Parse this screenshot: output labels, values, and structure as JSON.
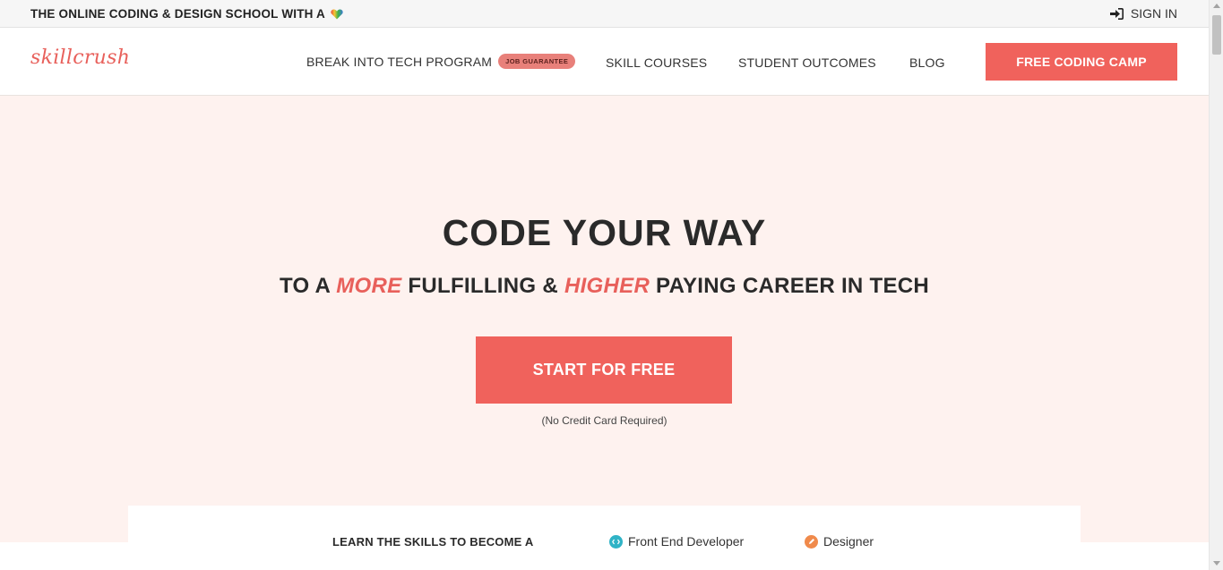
{
  "topbar": {
    "tagline": "THE ONLINE CODING & DESIGN SCHOOL WITH A",
    "tagline_icon": "rainbow-heart-icon",
    "signin_label": "SIGN IN",
    "signin_icon": "sign-in-arrow-icon"
  },
  "nav": {
    "logo": "skillcrush",
    "items": [
      {
        "label": "BREAK INTO TECH PROGRAM",
        "badge": "JOB GUARANTEE"
      },
      {
        "label": "SKILL COURSES"
      },
      {
        "label": "STUDENT OUTCOMES"
      },
      {
        "label": "BLOG"
      }
    ],
    "cta_label": "FREE CODING CAMP"
  },
  "hero": {
    "title": "CODE YOUR WAY",
    "subtitle_parts": [
      "TO A ",
      "MORE",
      " FULFILLING & ",
      "HIGHER",
      " PAYING CAREER IN TECH"
    ],
    "cta_label": "START FOR FREE",
    "note": "(No Credit Card Required)"
  },
  "skills": {
    "label": "LEARN THE SKILLS TO BECOME A",
    "items": [
      {
        "label": "Front End Developer",
        "icon": "code-icon",
        "color": "#2fb3c6"
      },
      {
        "label": "Designer",
        "icon": "pencil-icon",
        "color": "#f08a4b"
      }
    ]
  },
  "colors": {
    "brand": "#f0625c",
    "hero_bg": "#fef2ef",
    "badge": "#e8807a"
  }
}
